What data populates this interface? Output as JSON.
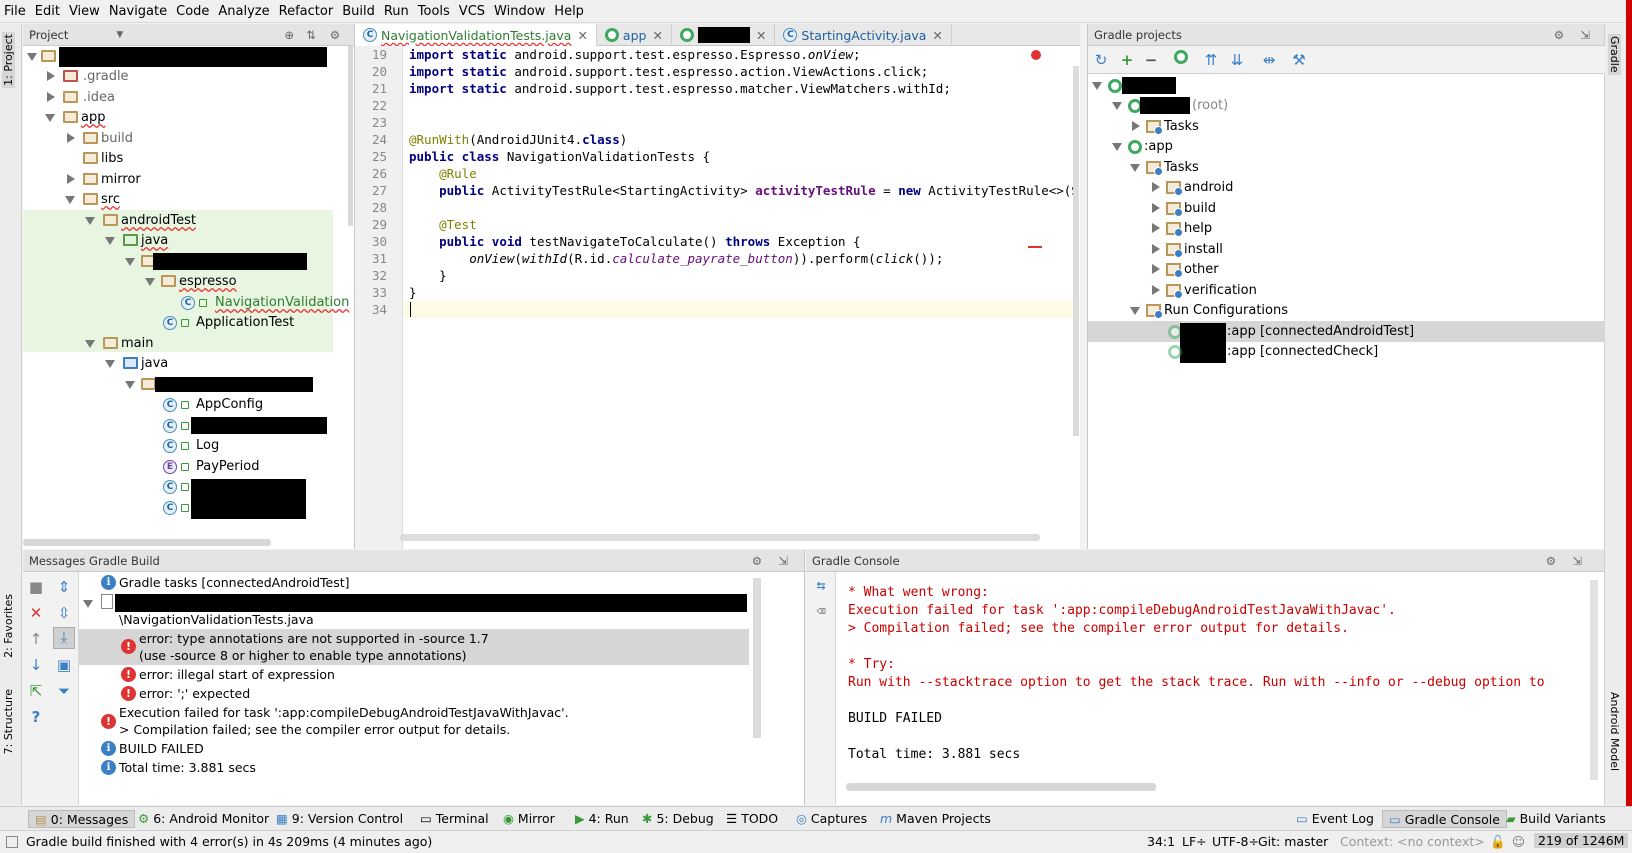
{
  "menu": [
    "File",
    "Edit",
    "View",
    "Navigate",
    "Code",
    "Analyze",
    "Refactor",
    "Build",
    "Run",
    "Tools",
    "VCS",
    "Window",
    "Help"
  ],
  "left_strip": {
    "project_tab": "1: Project",
    "favorites_tab": "2: Favorites",
    "structure_tab": "7: Structure"
  },
  "right_strip": {
    "gradle_tab": "Gradle",
    "android_model_tab": "Android Model"
  },
  "project_panel": {
    "title": "Project",
    "tree": [
      ".gradle",
      ".idea",
      "app",
      "build",
      "libs",
      "mirror",
      "src",
      "androidTest",
      "java",
      "espresso",
      "NavigationValidation",
      "ApplicationTest",
      "main",
      "java",
      "AppConfig",
      "Log",
      "PayPeriod"
    ]
  },
  "editor": {
    "tabs": [
      "NavigationValidationTests.java",
      "app",
      "StartingActivity.java"
    ],
    "line_numbers": [
      "19",
      "20",
      "21",
      "22",
      "23",
      "24",
      "25",
      "26",
      "27",
      "28",
      "29",
      "30",
      "31",
      "32",
      "33",
      "34"
    ]
  },
  "gradle_panel": {
    "title": "Gradle projects",
    "root_suffix": "(root)",
    "tasks_label": "Tasks",
    "app_label": ":app",
    "app_tasks": [
      "android",
      "build",
      "help",
      "install",
      "other",
      "verification"
    ],
    "run_configs_label": "Run Configurations",
    "run_configs": [
      ":app [connectedAndroidTest]",
      ":app [connectedCheck]"
    ]
  },
  "messages_panel": {
    "title": "Messages Gradle Build",
    "rows": {
      "tasks": "Gradle tasks [connectedAndroidTest]",
      "file": "\\NavigationValidationTests.java",
      "err1a": "error: type annotations are not supported in -source 1.7",
      "err1b": "(use -source 8 or higher to enable type annotations)",
      "err2": "error: illegal start of expression",
      "err3": "error: ';' expected",
      "exec_a": "Execution failed for task ':app:compileDebugAndroidTestJavaWithJavac'.",
      "exec_b": "> Compilation failed; see the compiler error output for details.",
      "failed": "BUILD FAILED",
      "total": "Total time: 3.881 secs"
    }
  },
  "console_panel": {
    "title": "Gradle Console",
    "lines": {
      "l1": "* What went wrong:",
      "l2": "Execution failed for task ':app:compileDebugAndroidTestJavaWithJavac'.",
      "l3": "> Compilation failed; see the compiler error output for details.",
      "l4": "* Try:",
      "l5": "Run with --stacktrace option to get the stack trace. Run with --info or --debug option to",
      "l6": "BUILD FAILED",
      "l7": "Total time: 3.881 secs"
    }
  },
  "bottom_tabs": {
    "messages": "0: Messages",
    "android_monitor": "6: Android Monitor",
    "version_control": "9: Version Control",
    "terminal": "Terminal",
    "mirror": "Mirror",
    "run": "4: Run",
    "debug": "5: Debug",
    "todo": "TODO",
    "captures": "Captures",
    "maven": "Maven Projects",
    "event_log": "Event Log",
    "gradle_console": "Gradle Console",
    "build_variants": "Build Variants"
  },
  "status_bar": {
    "message": "Gradle build finished with 4 error(s) in 4s 209ms (4 minutes ago)",
    "position": "34:1",
    "line_sep": "LF÷",
    "encoding": "UTF-8÷",
    "git": "Git: master",
    "context": "Context: <no context>",
    "memory": "219 of 1246M"
  },
  "colors": {
    "error_red": "#c80000",
    "accent": "#3b7fc4",
    "selection": "#d6d6d6"
  }
}
